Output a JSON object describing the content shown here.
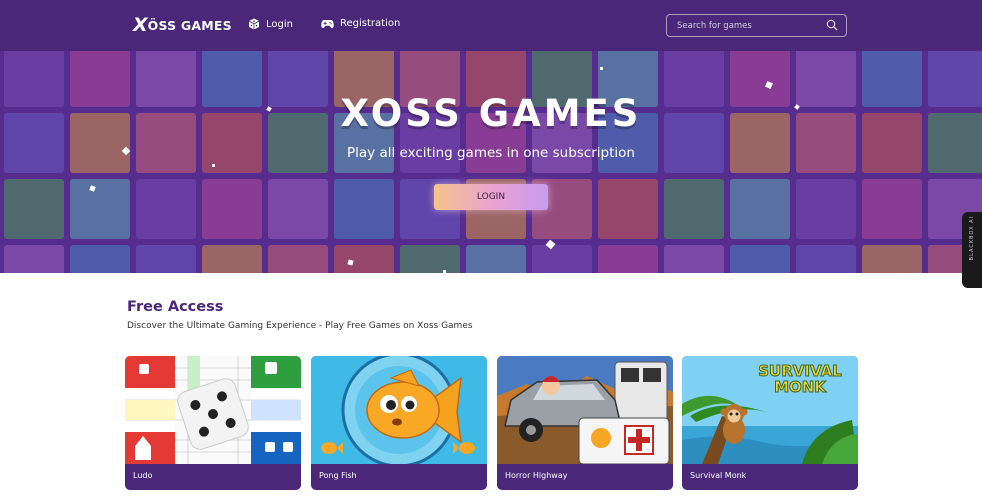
{
  "header": {
    "logo_mark": "X",
    "logo_text": "ÖSS GAMES",
    "nav": [
      {
        "label": "Login",
        "icon": "dice-icon"
      },
      {
        "label": "Registration",
        "icon": "gamepad-icon"
      }
    ],
    "search": {
      "placeholder": "Search for games",
      "icon": "search-icon"
    }
  },
  "hero": {
    "title": "XOSS GAMES",
    "subtitle": "Play all exciting games in one subscription",
    "button_label": "LOGIN"
  },
  "side_widget": {
    "label": "BLACKBOX AI"
  },
  "free_access": {
    "title": "Free Access",
    "description": "Discover the Ultimate Gaming Experience - Play Free Games on Xoss Games",
    "games": [
      {
        "title": "Ludo"
      },
      {
        "title": "Pong Fish"
      },
      {
        "title": "Horror Highway"
      },
      {
        "title": "Survival Monk"
      }
    ]
  },
  "colors": {
    "nav_bg": "#4a2778",
    "accent": "#4a2778",
    "card_bg": "#4a2778"
  }
}
